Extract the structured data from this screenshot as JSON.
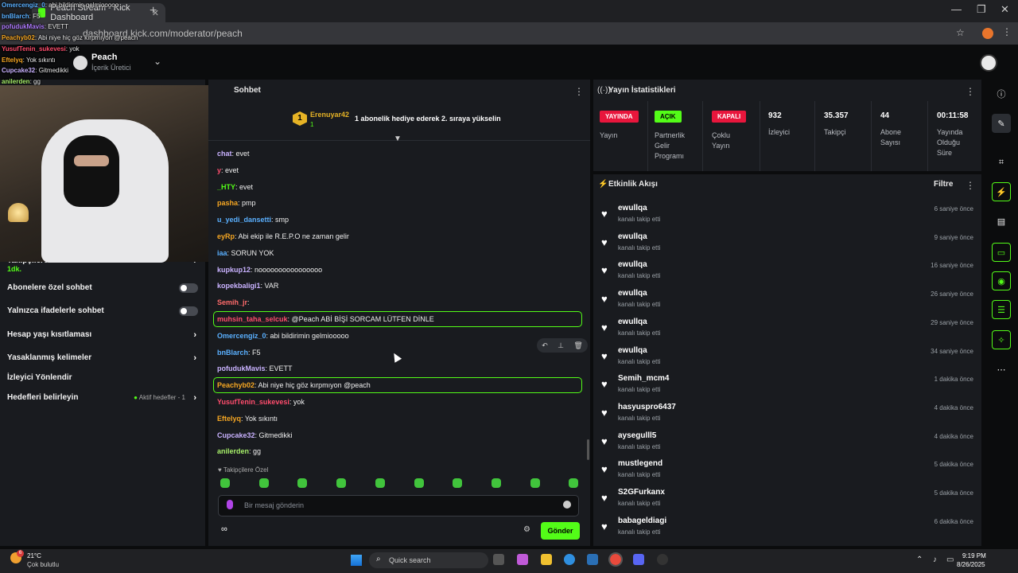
{
  "browser": {
    "tab_title": "Peach Stream - Kick Dashboard",
    "url": "dashboard.kick.com/moderator/peach",
    "tab_close": "✕",
    "new_tab": "+",
    "minimize": "—",
    "restore": "❐",
    "close": "✕",
    "star": "☆",
    "menu": "⋮"
  },
  "channel": {
    "name": "Peach",
    "role": "İçerik Üretici",
    "switch_icon": "⌄"
  },
  "overlay_chat": [
    {
      "user": "Omercengiz_0",
      "text": ": abi bildirimin gelmiooooo",
      "color": "#5ab0ff"
    },
    {
      "user": "bnBlarch",
      "text": ": F5",
      "color": "#5ab0ff"
    },
    {
      "user": "pofudukMavis",
      "text": ": EVETT",
      "color": "#b07bff"
    },
    {
      "user": "Peachyb02",
      "text": ": Abi niye hiç göz kırpmıyon @peach",
      "color": "#f5a623"
    },
    {
      "user": "YusufTenin_sukevesi",
      "text": ": yok",
      "color": "#ff4d6d"
    },
    {
      "user": "Eftelyq",
      "text": ": Yok sıkıntı",
      "color": "#f5a623"
    },
    {
      "user": "Cupcake32",
      "text": ": Gitmedikki",
      "color": "#c9b2ff"
    },
    {
      "user": "anilerden",
      "text": ": gg",
      "color": "#a7f06a"
    }
  ],
  "left_settings": {
    "partial_label": "Takipçilere özel sohbet",
    "partial_value": "1dk.",
    "subscribers_only": "Abonelere özel sohbet",
    "emotes_only": "Yalnızca ifadelerle sohbet",
    "account_age": "Hesap yaşı kısıtlaması",
    "banned_words": "Yasaklanmış kelimeler",
    "viewer_guidelines": "İzleyici Yönlendir",
    "goals": "Hedefleri belirleyin",
    "goals_status": "Aktif hedefler - 1"
  },
  "chat": {
    "title": "Sohbet",
    "menu": "⋮",
    "pinned": {
      "rank": "1",
      "user": "Erenuyar42",
      "count": "1",
      "text": "1 abonelik hediye ederek 2. sıraya yükselin"
    },
    "messages": [
      {
        "user": "chat",
        "text": ": evet",
        "color": "#c9b2ff"
      },
      {
        "user": "y",
        "text": ": evet",
        "color": "#ff4d6d"
      },
      {
        "user": "_HTY",
        "text": ": evet",
        "color": "#53fc18"
      },
      {
        "user": "pasha",
        "text": ": pmp",
        "color": "#f5a623"
      },
      {
        "user": "u_yedi_dansetti",
        "text": ": smp",
        "color": "#5ab0ff"
      },
      {
        "user": "eyRp",
        "text": ": Abi ekip ile R.E.P.O ne zaman gelir",
        "color": "#f5a623"
      },
      {
        "user": "iaa",
        "text": ": SORUN YOK",
        "color": "#5ab0ff"
      },
      {
        "user": "kupkup12",
        "text": ": noooooooooooooooo",
        "color": "#c9b2ff"
      },
      {
        "user": "kopekbaligi1",
        "text": ": VAR",
        "color": "#c9b2ff"
      },
      {
        "user": "Semih_jr",
        "text": ":",
        "color": "#ff6b6b"
      },
      {
        "user": "muhsin_taha_selcuk",
        "text": ": @Peach ABİ BİŞİ SORCAM LÜTFEN DİNLE",
        "color": "#ff4d6d"
      },
      {
        "user": "Omercengiz_0",
        "text": ": abi bildirimin gelmiooooo",
        "color": "#5ab0ff"
      },
      {
        "user": "bnBlarch",
        "text": ": F5",
        "color": "#5ab0ff"
      },
      {
        "user": "pofudukMavis",
        "text": ": EVETT",
        "color": "#c9b2ff"
      },
      {
        "user": "Peachyb02",
        "text": ": Abi niye hiç göz kırpmıyon @peach",
        "color": "#f5a623"
      },
      {
        "user": "YusufTenin_sukevesi",
        "text": ": yok",
        "color": "#ff4d6d"
      },
      {
        "user": "Eftelyq",
        "text": ": Yok sıkıntı",
        "color": "#f5a623"
      },
      {
        "user": "Cupcake32",
        "text": ": Gitmedikki",
        "color": "#c9b2ff"
      },
      {
        "user": "anilerden",
        "text": ": gg",
        "color": "#a7f06a"
      }
    ],
    "mod_tools": {
      "undo": "↶",
      "pin": "⊥",
      "delete": "🗑"
    },
    "followers_only": "Takipçilere Özel",
    "input_placeholder": "Bir mesaj gönderin",
    "send": "Gönder",
    "infinity": "∞",
    "gear": "⚙"
  },
  "stats": {
    "title": "Yayın İstatistikleri",
    "menu": "⋮",
    "stream_badge": "YAYINDA",
    "stream_label": "Yayın",
    "partner_badge": "AÇIK",
    "partner_label": "Partnerlik Gelir Programı",
    "multi_badge": "KAPALI",
    "multi_label": "Çoklu Yayın",
    "viewers": "932",
    "viewers_label": "İzleyici",
    "followers": "35.357",
    "followers_label": "Takipçi",
    "subs": "44",
    "subs_label": "Abone Sayısı",
    "uptime": "00:11:58",
    "uptime_label": "Yayında Olduğu Süre"
  },
  "feed": {
    "title": "Etkinlik Akışı",
    "filter": "Filtre",
    "menu": "⋮",
    "items": [
      {
        "user": "ewullqa",
        "action": "kanalı takip etti",
        "time": "6 saniye önce"
      },
      {
        "user": "ewullqa",
        "action": "kanalı takip etti",
        "time": "9 saniye önce"
      },
      {
        "user": "ewullqa",
        "action": "kanalı takip etti",
        "time": "16 saniye önce"
      },
      {
        "user": "ewullqa",
        "action": "kanalı takip etti",
        "time": "26 saniye önce"
      },
      {
        "user": "ewullqa",
        "action": "kanalı takip etti",
        "time": "29 saniye önce"
      },
      {
        "user": "ewullqa",
        "action": "kanalı takip etti",
        "time": "34 saniye önce"
      },
      {
        "user": "Semih_mcm4",
        "action": "kanalı takip etti",
        "time": "1 dakika önce"
      },
      {
        "user": "hasyuspro6437",
        "action": "kanalı takip etti",
        "time": "4 dakika önce"
      },
      {
        "user": "aysegulll5",
        "action": "kanalı takip etti",
        "time": "4 dakika önce"
      },
      {
        "user": "mustlegend",
        "action": "kanalı takip etti",
        "time": "5 dakika önce"
      },
      {
        "user": "S2GFurkanx",
        "action": "kanalı takip etti",
        "time": "5 dakika önce"
      },
      {
        "user": "babageldiagi",
        "action": "kanalı takip etti",
        "time": "6 dakika önce"
      }
    ]
  },
  "taskbar": {
    "weather_badge": "6",
    "temp": "21°C",
    "weather": "Çok bulutlu",
    "search": "Quick search",
    "time": "9:19 PM",
    "date": "8/26/2025"
  },
  "colors": {
    "accent": "#53fc18",
    "live": "#e8163c"
  }
}
